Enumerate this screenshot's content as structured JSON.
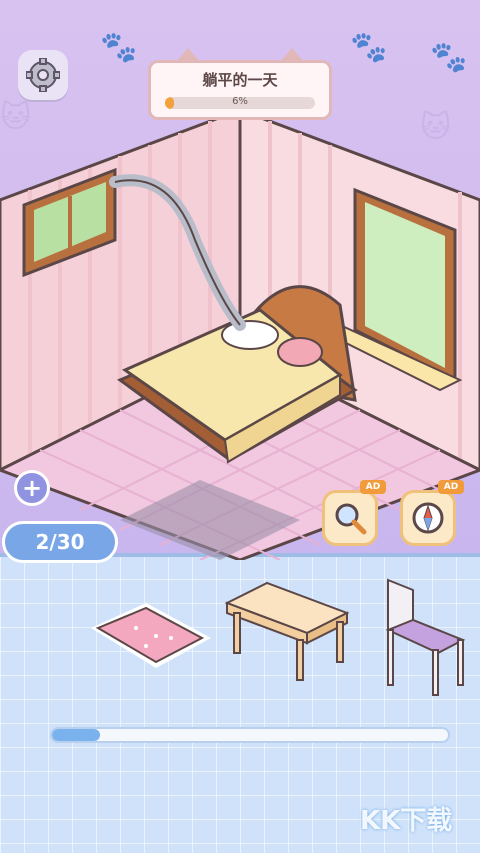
{
  "header": {
    "level_title": "躺平的一天",
    "progress_label": "6%",
    "progress_fraction": 0.06
  },
  "level_counter": "2/30",
  "buttons": {
    "add": "+",
    "magnifier_ad": "AD",
    "compass_ad": "AD"
  },
  "inventory": {
    "items": [
      "pink-rug",
      "wooden-table",
      "chair"
    ],
    "scroll_fraction": 0.12
  },
  "watermark": "KK下载"
}
